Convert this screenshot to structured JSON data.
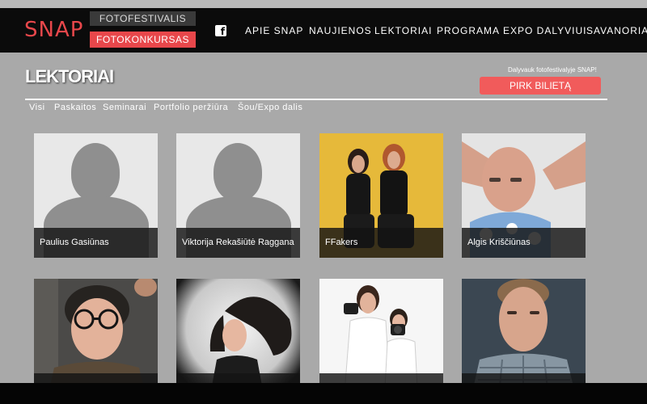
{
  "header": {
    "logo_prefix": "SNA",
    "logo_letter": "P",
    "festival_tab": "FOTOFESTIVALIS",
    "contest_tab": "FOTOKONKURSAS",
    "facebook_icon": "f",
    "nav": [
      "APIE SNAP",
      "NAUJIENOS",
      "LEKTORIAI",
      "PROGRAMA",
      "EXPO DALYVIUI",
      "SAVANORIAI"
    ]
  },
  "page": {
    "title": "LEKTORIAI",
    "promo_text": "Dalyvauk fotofestivalyje SNAP!",
    "buy_button": "PIRK BILIETĄ"
  },
  "filters": [
    "Visi",
    "Paskaitos",
    "Seminarai",
    "Portfolio peržiūra",
    "Šou/Expo dalis"
  ],
  "speakers": [
    {
      "name": "Paulius Gasiūnas",
      "photo": "placeholder-silhouette"
    },
    {
      "name": "Viktorija Rekašiūtė Raggana",
      "photo": "placeholder-silhouette"
    },
    {
      "name": "FFakers",
      "photo": "duo-on-yellow"
    },
    {
      "name": "Algis Kriščiūnas",
      "photo": "bald-man-hands-behind-head"
    },
    {
      "name": "",
      "photo": "man-with-glasses"
    },
    {
      "name": "",
      "photo": "woman-flowing-hair"
    },
    {
      "name": "",
      "photo": "photographer-duo-with-cameras"
    },
    {
      "name": "",
      "photo": "man-plaid-shirt"
    }
  ],
  "colors": {
    "accent": "#e8474b",
    "header_bg": "#0b0b0b",
    "page_bg": "#a9a9a9",
    "button": "#f15b5b"
  }
}
